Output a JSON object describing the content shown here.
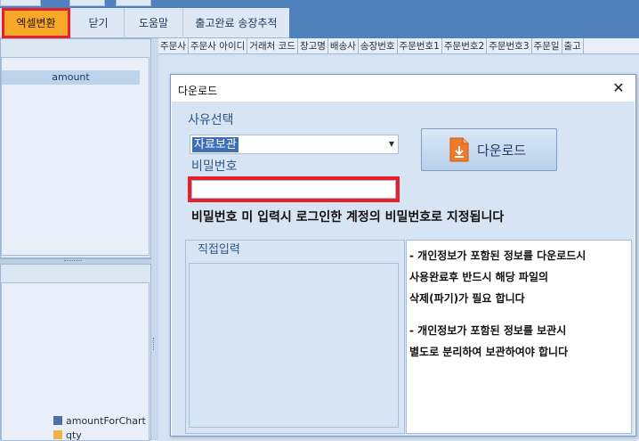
{
  "toolbar": {
    "excel_label": "엑셀변환",
    "close_label": "닫기",
    "help_label": "도움말",
    "tracking_label": "출고완료 송장추적"
  },
  "grid_columns": [
    "주문사",
    "주문사 아이디",
    "거래처 코드",
    "창고명",
    "배송사",
    "송장번호",
    "주문번호1",
    "주문번호2",
    "주문번호3",
    "주문일",
    "출고"
  ],
  "left_panel": {
    "selected_field": "amount",
    "legend": [
      {
        "label": "amountForChart",
        "color": "#4f6fa8"
      },
      {
        "label": "qty",
        "color": "#f2b24a"
      }
    ]
  },
  "dialog": {
    "title": "다운로드",
    "reason_label": "사유선택",
    "reason_value": "자료보관",
    "password_label": "비밀번호",
    "password_value": "",
    "download_button": "다운로드",
    "notice": "비밀번호 미 입력시 로그인한 계정의 비밀번호로 지정됩니다",
    "direct_input_label": "직접입력",
    "direct_input_value": "",
    "info_lines": [
      "- 개인정보가 포함된 정보를 다운로드시",
      "사용완료후 반드시 해당 파일의",
      "삭제(파기)가 필요 합니다",
      "- 개인정보가 포함된 정보를 보관시",
      "별도로 분리하여 보관하여야 합니다"
    ]
  }
}
